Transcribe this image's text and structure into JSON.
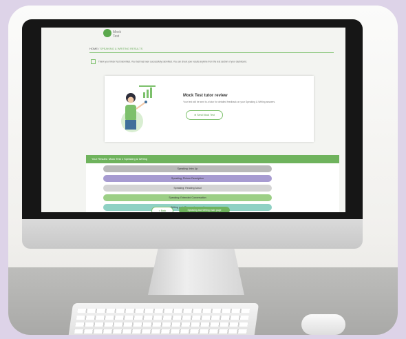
{
  "header": {
    "logo_text": "Mock Test",
    "breadcrumb_home": "HOME",
    "breadcrumb_current": "SPEAKING & WRITING RESULTS"
  },
  "notice": "Thank you! Mock Test Submitted. Your test has been successfully submitted. You can check your results anytime from the test section of your dashboard.",
  "review_card": {
    "title": "Mock Test tutor review",
    "subtitle": "Your test will be sent to a tutor for detailed feedback on your Speaking & Writing answers.",
    "button_label": "Send Mock Test"
  },
  "results": {
    "header": "Your Results: Mock Test 1 Speaking & Writing",
    "tasks": [
      {
        "label": "Speaking: Intro Up",
        "color": "#b9b9b9"
      },
      {
        "label": "Speaking: Picture Description",
        "color": "#a79bd1"
      },
      {
        "label": "Speaking: Reading Aloud",
        "color": "#d4d4d4"
      },
      {
        "label": "Speaking: Extended Conversation",
        "color": "#9ccf86"
      },
      {
        "label": "Writing part: Respond an email",
        "color": "#8fd1c4"
      }
    ],
    "back_label": "< Back",
    "next_label": "Speaking and Writing main page"
  }
}
